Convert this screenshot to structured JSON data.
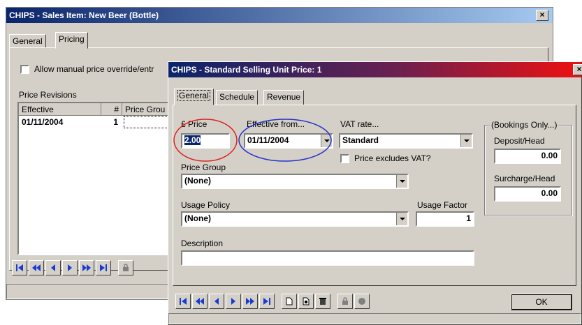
{
  "back_window": {
    "title": "CHIPS - Sales Item: New Beer (Bottle)",
    "close_glyph": "×",
    "tabs": [
      {
        "label": "General",
        "active": false
      },
      {
        "label": "Pricing",
        "active": true
      }
    ],
    "allow_override_label": "Allow manual price override/entr",
    "price_revisions_label": "Price Revisions",
    "grid": {
      "headers": [
        "Effective",
        "#",
        "Price Grou"
      ],
      "rows": [
        {
          "effective": "01/11/2004",
          "num": "1",
          "price_group": ""
        }
      ]
    },
    "nav_icons": [
      "first-record-icon",
      "prev-page-icon",
      "prev-record-icon",
      "next-record-icon",
      "next-page-icon",
      "last-record-icon",
      "lock-icon"
    ]
  },
  "front_window": {
    "title": "CHIPS - Standard Selling Unit Price: 1",
    "close_glyph": "×",
    "title_gradient": [
      "#0a246a",
      "#a6202a",
      "#ee1010"
    ],
    "tabs": [
      {
        "label": "General",
        "active": true
      },
      {
        "label": "Schedule",
        "active": false
      },
      {
        "label": "Revenue",
        "active": false
      }
    ],
    "price": {
      "label": "£ Price",
      "value": "2.00"
    },
    "effective_from": {
      "label": "Effective from...",
      "value": "01/11/2004"
    },
    "vat_rate": {
      "label": "VAT rate...",
      "value": "Standard"
    },
    "price_excludes_vat": {
      "label": "Price excludes VAT?",
      "checked": false
    },
    "price_group": {
      "label": "Price Group",
      "value": "(None)"
    },
    "usage_policy": {
      "label": "Usage Policy",
      "value": "(None)"
    },
    "usage_factor": {
      "label": "Usage Factor",
      "value": "1"
    },
    "description": {
      "label": "Description",
      "value": ""
    },
    "bookings_group": {
      "label": "(Bookings Only...)",
      "deposit": {
        "label": "Deposit/Head",
        "value": "0.00"
      },
      "surcharge": {
        "label": "Surcharge/Head",
        "value": "0.00"
      }
    },
    "ok_label": "OK",
    "nav_icons": [
      "first-record-icon",
      "prev-page-icon",
      "prev-record-icon",
      "next-record-icon",
      "next-page-icon",
      "last-record-icon",
      "new-record-icon",
      "copy-record-icon",
      "delete-record-icon",
      "lock-icon",
      "circle-icon"
    ]
  },
  "annotations": {
    "price_circle_color": "#dd2222",
    "effective_circle_color": "#2233cc"
  }
}
